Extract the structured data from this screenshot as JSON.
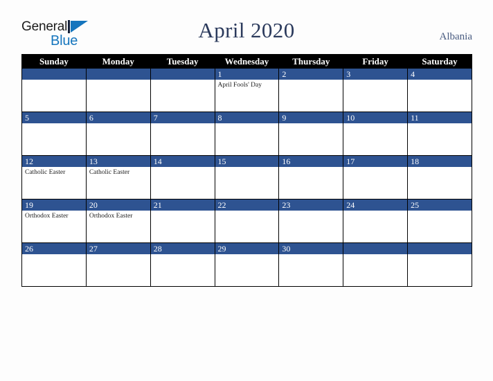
{
  "logo": {
    "word_top": "General",
    "word_bottom": "Blue",
    "mark": "triangle-mark",
    "color_blue": "#1575bd",
    "color_dark": "#1b1b1b"
  },
  "header": {
    "title": "April 2020",
    "country": "Albania",
    "title_color": "#2b3a5c",
    "country_color": "#46597e"
  },
  "calendar": {
    "accent_color": "#2e5391",
    "header_bg": "#000000",
    "weekday_headers": [
      "Sunday",
      "Monday",
      "Tuesday",
      "Wednesday",
      "Thursday",
      "Friday",
      "Saturday"
    ],
    "weeks": [
      [
        {
          "day": "",
          "events": []
        },
        {
          "day": "",
          "events": []
        },
        {
          "day": "",
          "events": []
        },
        {
          "day": "1",
          "events": [
            "April Fools' Day"
          ]
        },
        {
          "day": "2",
          "events": []
        },
        {
          "day": "3",
          "events": []
        },
        {
          "day": "4",
          "events": []
        }
      ],
      [
        {
          "day": "5",
          "events": []
        },
        {
          "day": "6",
          "events": []
        },
        {
          "day": "7",
          "events": []
        },
        {
          "day": "8",
          "events": []
        },
        {
          "day": "9",
          "events": []
        },
        {
          "day": "10",
          "events": []
        },
        {
          "day": "11",
          "events": []
        }
      ],
      [
        {
          "day": "12",
          "events": [
            "Catholic Easter"
          ]
        },
        {
          "day": "13",
          "events": [
            "Catholic Easter"
          ]
        },
        {
          "day": "14",
          "events": []
        },
        {
          "day": "15",
          "events": []
        },
        {
          "day": "16",
          "events": []
        },
        {
          "day": "17",
          "events": []
        },
        {
          "day": "18",
          "events": []
        }
      ],
      [
        {
          "day": "19",
          "events": [
            "Orthodox Easter"
          ]
        },
        {
          "day": "20",
          "events": [
            "Orthodox Easter"
          ]
        },
        {
          "day": "21",
          "events": []
        },
        {
          "day": "22",
          "events": []
        },
        {
          "day": "23",
          "events": []
        },
        {
          "day": "24",
          "events": []
        },
        {
          "day": "25",
          "events": []
        }
      ],
      [
        {
          "day": "26",
          "events": []
        },
        {
          "day": "27",
          "events": []
        },
        {
          "day": "28",
          "events": []
        },
        {
          "day": "29",
          "events": []
        },
        {
          "day": "30",
          "events": []
        },
        {
          "day": "",
          "events": []
        },
        {
          "day": "",
          "events": []
        }
      ]
    ]
  }
}
